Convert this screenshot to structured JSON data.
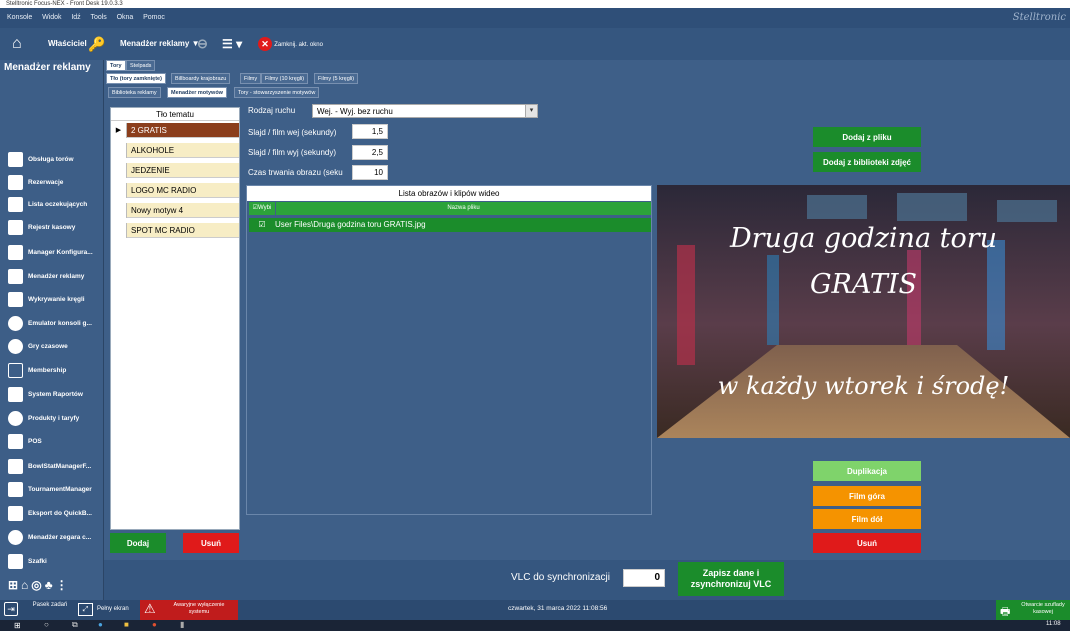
{
  "window": {
    "title": "Stelltronic Focus-NEX - Front Desk 19.0.3.3"
  },
  "menu": [
    "Konsole",
    "Widok",
    "Idź",
    "Tools",
    "Okna",
    "Pomoc"
  ],
  "toolbar": {
    "owner": "Właściciel",
    "ad_manager": "Menadżer reklamy",
    "close_window": "Zamknij. akt. okno",
    "brand": "Stelltronic"
  },
  "sidebar": {
    "title": "Menadżer reklamy",
    "items": [
      "Obsługa torów",
      "Rezerwacje",
      "Lista oczekujących",
      "Rejestr kasowy",
      "Manager Konfigura...",
      "Menadżer reklamy",
      "Wykrywanie kręgli",
      "Emulator konsoli g...",
      "Gry czasowe",
      "Membership",
      "System Raportów",
      "Produkty i taryfy",
      "POS",
      "BowlStatManagerF...",
      "TournamentManager",
      "Eksport do QuickB...",
      "Menadżer zegara c...",
      "Szafki"
    ]
  },
  "tabs": {
    "row1": [
      "Tory",
      "Stelpads"
    ],
    "row2": [
      "Tło (tory zamknięte)",
      "Billboardy krajobrazu",
      "Filmy",
      "Filmy (10 kręgli)",
      "Filmy (5 kręgli)"
    ],
    "row3": [
      "Biblioteka reklamy",
      "Menadżer motywów",
      "Tory - stowarzyszenie motywów"
    ]
  },
  "themes": {
    "header": "Tło tematu",
    "items": [
      "2 GRATIS",
      "ALKOHOLE",
      "JEDZENIE",
      "LOGO MC RADIO",
      "Nowy motyw 4",
      "SPOT MC RADIO"
    ],
    "add": "Dodaj",
    "remove": "Usuń"
  },
  "form": {
    "motion_label": "Rodzaj ruchu",
    "motion_value": "Wej. - Wyj. bez ruchu",
    "slide_in_label": "Slajd / film wej (sekundy)",
    "slide_in_value": "1,5",
    "slide_out_label": "Slajd / film wyj (sekundy)",
    "slide_out_value": "2,5",
    "duration_label": "Czas trwania obrazu (seku",
    "duration_value": "10"
  },
  "imagelist": {
    "title": "Lista obrazów i klipów wideo",
    "col_select": "Wybi",
    "col_name": "Nazwa pliku",
    "rows": [
      {
        "name": "User Files\\Druga godzina toru GRATIS.jpg"
      }
    ]
  },
  "preview": {
    "line1": "Druga godzina toru",
    "line2": "GRATIS",
    "line3": "w każdy wtorek i środę!"
  },
  "right_buttons": {
    "add_file": "Dodaj z pliku",
    "add_library": "Dodaj z biblioteki zdjęć",
    "duplicate": "Duplikacja",
    "move_up": "Film góra",
    "move_down": "Film dół",
    "remove": "Usuń"
  },
  "bottom": {
    "vlc_label": "VLC do synchronizacji",
    "vlc_value": "0",
    "save_sync": "Zapisz dane i zsynchronizuj VLC"
  },
  "status": {
    "taskbar": "Pasek zadań",
    "fullscreen": "Pełny ekran",
    "emergency": "Awaryjne wyłączenie systemu",
    "datetime": "czwartek, 31 marca 2022 11:08:56",
    "cash_drawer": "Otwarcie szuflady kasowej",
    "clock": "11:08"
  },
  "colors": {
    "bg": "#3e5f88",
    "green": "#1b8c2b",
    "red": "#e01a1a",
    "orange": "#f59300",
    "light_green": "#7fd36b"
  }
}
